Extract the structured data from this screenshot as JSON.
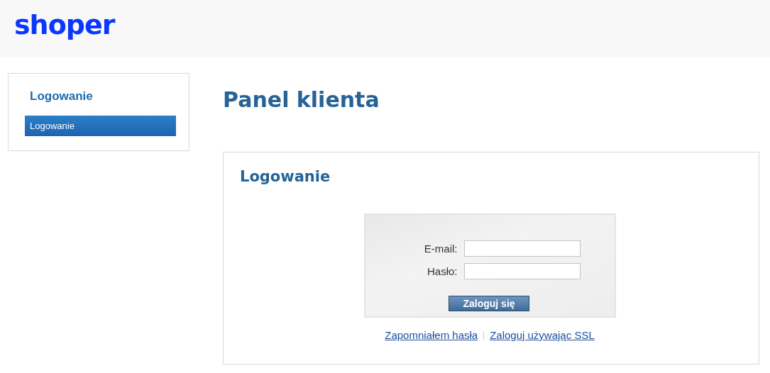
{
  "logo": "shoper",
  "sidebar": {
    "title": "Logowanie",
    "items": [
      {
        "label": "Logowanie",
        "selected": true
      }
    ]
  },
  "page_title": "Panel klienta",
  "panel": {
    "title": "Logowanie",
    "fields": [
      {
        "label": "E-mail:"
      },
      {
        "label": "Hasło:"
      }
    ],
    "submit": "Zaloguj się",
    "links": [
      "Zapomniałem hasła",
      "Zaloguj używając SSL"
    ]
  }
}
